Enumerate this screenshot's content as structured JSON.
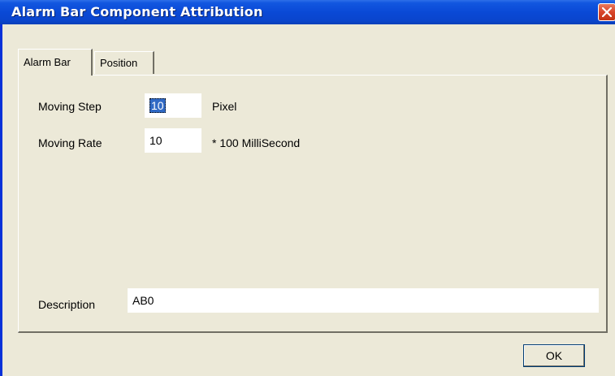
{
  "window": {
    "title": "Alarm Bar Component Attribution",
    "title_color": "#0a45cc"
  },
  "tabs": [
    {
      "label": "Alarm Bar",
      "active": true
    },
    {
      "label": "Position",
      "active": false
    }
  ],
  "fields": {
    "moving_step": {
      "label": "Moving Step",
      "value": "10",
      "unit": "Pixel"
    },
    "moving_rate": {
      "label": "Moving Rate",
      "value": "10",
      "unit": "* 100 MilliSecond"
    },
    "description": {
      "label": "Description",
      "value": "AB0"
    }
  },
  "buttons": {
    "ok_label": "OK",
    "close_icon": "close-icon"
  }
}
